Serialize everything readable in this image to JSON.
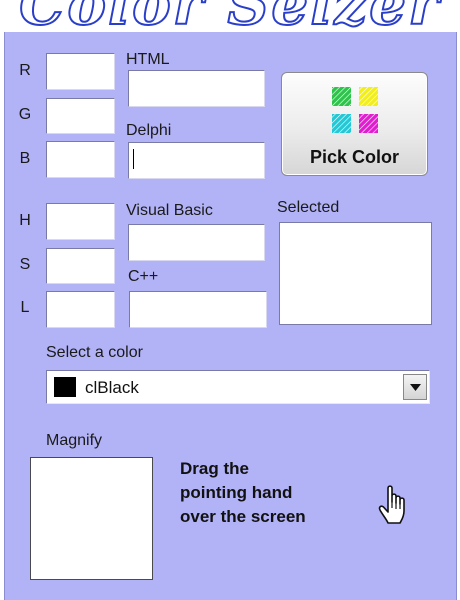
{
  "banner": {
    "title": "Color Seizer"
  },
  "rgb": {
    "r_label": "R",
    "g_label": "G",
    "b_label": "B",
    "r_value": "",
    "g_value": "",
    "b_value": ""
  },
  "hsl": {
    "h_label": "H",
    "s_label": "S",
    "l_label": "L",
    "h_value": "",
    "s_value": "",
    "l_value": ""
  },
  "codes": {
    "html_label": "HTML",
    "delphi_label": "Delphi",
    "vb_label": "Visual Basic",
    "cpp_label": "C++",
    "html_value": "",
    "delphi_value": "",
    "vb_value": "",
    "cpp_value": ""
  },
  "pick_button": {
    "label": "Pick Color",
    "icon": "pick-color-icon"
  },
  "selected": {
    "label": "Selected",
    "color": "#ffffff"
  },
  "color_select": {
    "label": "Select a color",
    "value": "clBlack",
    "swatch_color": "#000000"
  },
  "magnify": {
    "label": "Magnify"
  },
  "instructions": {
    "line1": "Drag the",
    "line2": "pointing hand",
    "line3": "over the screen",
    "icon": "pointing-hand-icon"
  },
  "colors": {
    "panel": "#b2b2f6",
    "banner_text": "#2a3fc9"
  }
}
